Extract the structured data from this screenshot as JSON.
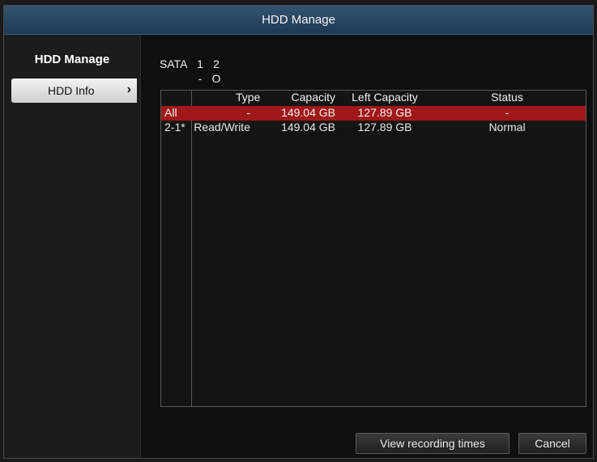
{
  "window": {
    "title": "HDD Manage"
  },
  "sidebar": {
    "heading": "HDD Manage",
    "items": [
      {
        "label": "HDD Info",
        "icon": "chevron-right-icon"
      }
    ]
  },
  "sata": {
    "label": "SATA",
    "ports": [
      "1",
      "2"
    ],
    "status": [
      "-",
      "O"
    ]
  },
  "table": {
    "headers": {
      "type": "Type",
      "capacity": "Capacity",
      "left_capacity": "Left Capacity",
      "status": "Status"
    },
    "rows": [
      {
        "id": "All",
        "type": "-",
        "capacity": "149.04 GB",
        "left_capacity": "127.89 GB",
        "status": "-",
        "selected": true
      },
      {
        "id": "2-1*",
        "type": "Read/Write",
        "capacity": "149.04 GB",
        "left_capacity": "127.89 GB",
        "status": "Normal",
        "selected": false
      }
    ]
  },
  "buttons": {
    "view_recording_times": "View recording times",
    "cancel": "Cancel"
  },
  "colors": {
    "title_bar": "#1e3a55",
    "selected_row": "#a01818"
  }
}
